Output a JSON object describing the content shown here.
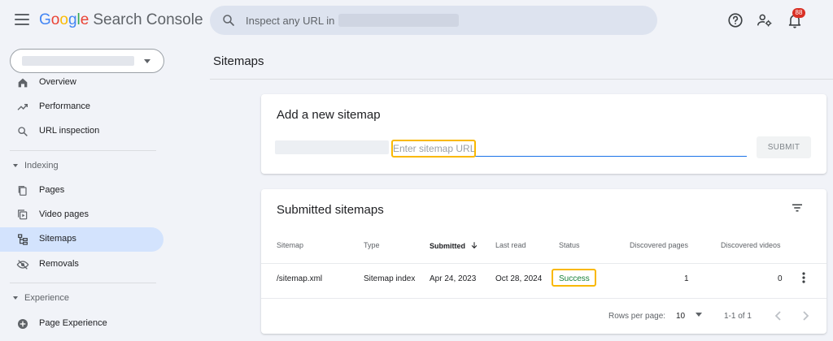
{
  "header": {
    "logo": {
      "google": [
        "G",
        "o",
        "o",
        "g",
        "l",
        "e"
      ],
      "product": "Search Console"
    },
    "search_placeholder": "Inspect any URL in",
    "notification_count": "88",
    "icons": [
      "menu-icon",
      "search-icon",
      "help-icon",
      "manage-users-icon",
      "bell-icon"
    ]
  },
  "sidebar": {
    "items_top": [
      {
        "label": "Overview",
        "icon": "home-icon"
      },
      {
        "label": "Performance",
        "icon": "trending-up-icon"
      },
      {
        "label": "URL inspection",
        "icon": "search-icon"
      }
    ],
    "section_indexing": "Indexing",
    "items_indexing": [
      {
        "label": "Pages",
        "icon": "pages-icon"
      },
      {
        "label": "Video pages",
        "icon": "video-pages-icon"
      },
      {
        "label": "Sitemaps",
        "icon": "sitemap-icon",
        "active": true
      },
      {
        "label": "Removals",
        "icon": "removals-icon"
      }
    ],
    "section_experience": "Experience",
    "items_experience": [
      {
        "label": "Page Experience",
        "icon": "page-experience-icon"
      }
    ]
  },
  "main": {
    "title": "Sitemaps",
    "add_card": {
      "title": "Add a new sitemap",
      "input_placeholder": "Enter sitemap URL",
      "submit_label": "SUBMIT"
    },
    "submitted_card": {
      "title": "Submitted sitemaps",
      "columns": [
        "Sitemap",
        "Type",
        "Submitted",
        "Last read",
        "Status",
        "Discovered pages",
        "Discovered videos"
      ],
      "rows": [
        {
          "sitemap": "/sitemap.xml",
          "type": "Sitemap index",
          "submitted": "Apr 24, 2023",
          "last_read": "Oct 28, 2024",
          "status": "Success",
          "discovered_pages": "1",
          "discovered_videos": "0"
        }
      ],
      "pager": {
        "rows_per_page_label": "Rows per page:",
        "rows_per_page": "10",
        "range": "1-1 of 1"
      }
    }
  },
  "colors": {
    "accent": "#1a73e8",
    "success": "#188038",
    "highlight": "#f9b800",
    "active_nav": "#d3e3fd",
    "badge": "#d93025"
  }
}
